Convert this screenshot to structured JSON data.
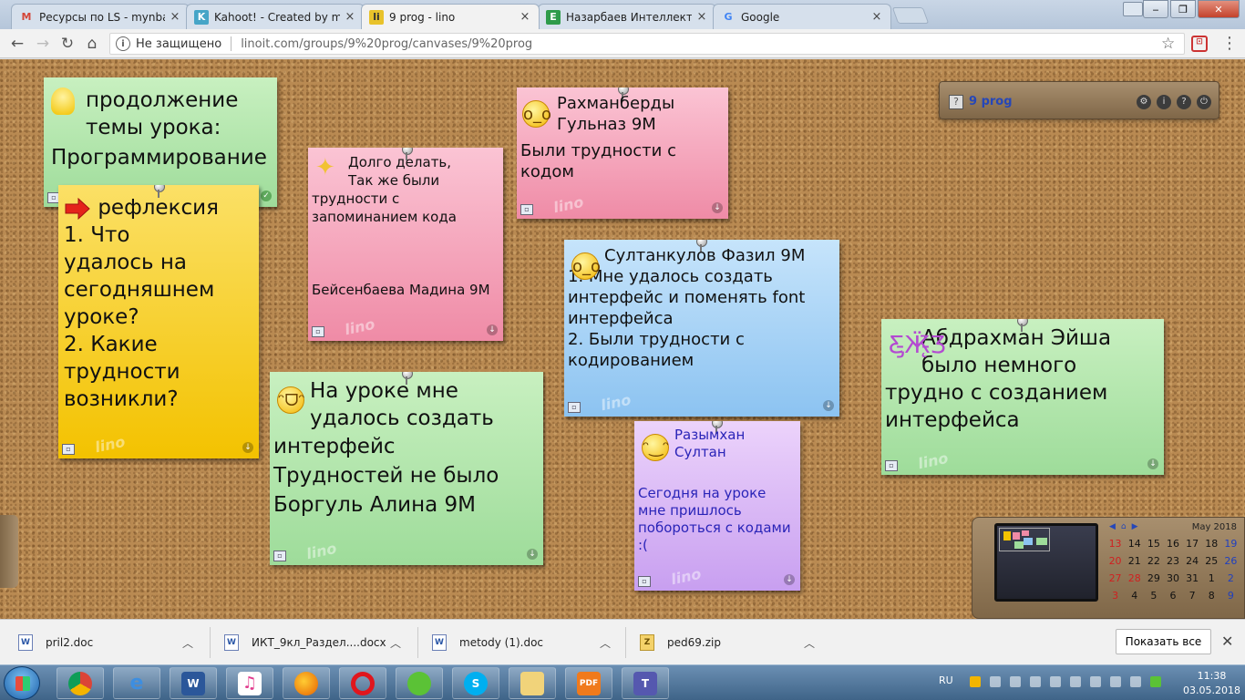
{
  "browser": {
    "tabs": [
      {
        "title": "Ресурсы по LS - mynbae",
        "favicon": "gmail-icon",
        "color": "#d44638",
        "glyph": "M"
      },
      {
        "title": "Kahoot! - Created by me",
        "favicon": "kahoot-icon",
        "color": "#46a5c7",
        "glyph": "K!"
      },
      {
        "title": "9 prog - lino",
        "favicon": "lino-icon",
        "color": "#e8c22a",
        "glyph": "li"
      },
      {
        "title": "Назарбаев Интеллектуа",
        "favicon": "sheet-icon",
        "color": "#2e9b4a",
        "glyph": "E"
      },
      {
        "title": "Google",
        "favicon": "google-icon",
        "color": "#4285f4",
        "glyph": "G"
      }
    ],
    "security_label": "Не защищено",
    "url": "linoit.com/groups/9%20prog/canvases/9%20prog"
  },
  "board": {
    "group_name": "9 prog",
    "group_panel_icons": [
      "settings-icon",
      "info-icon",
      "help-icon",
      "power-icon"
    ],
    "notes": [
      {
        "id": "n1",
        "emoji": "lightbulb-icon",
        "title": "продолжение\nтемы урока:",
        "body": "Программирование"
      },
      {
        "id": "n2",
        "emoji": "red-arrow-icon",
        "title": "рефлексия",
        "body": "     1. Что\nудалось на\nсегодняшнем\nуроке?\n2. Какие\nтрудности\nвозникли?"
      },
      {
        "id": "n3",
        "emoji": "sparkles-icon",
        "title": "Долго делать,\nТак же были",
        "body": "трудности с\nзапоминанием кода\n\n\n\nБейсенбаева Мадина 9М"
      },
      {
        "id": "n4",
        "emoji": "surprised-face-icon",
        "title": "Рахманберды\nГульназ 9М",
        "body": "Были трудности с\nкодом"
      },
      {
        "id": "n5",
        "emoji": "surprised-face-icon",
        "title": "Султанкулов Фазил 9М",
        "body": "     1. Мне удалось создать\nинтерфейс и поменять font\nинтерфейса\n2. Были трудности с\nкодированием"
      },
      {
        "id": "n6",
        "emoji": "grinning-face-icon",
        "title": "На уроке мне\nудалось создать",
        "body": "интерфейс\nТрудностей не было\nБоргуль Алина 9М"
      },
      {
        "id": "n7",
        "emoji": "smiling-face-icon",
        "title": "Разымхан\nСултан",
        "body": "Сегодня на уроке\nмне пришлось\nпобороться с кодами\n:("
      },
      {
        "id": "n8",
        "emoji": "butterfly-icon",
        "title": "Абдрахман Эйша\nбыло немного",
        "body": "трудно с созданием\nинтерфейса"
      }
    ],
    "watermark": "lino"
  },
  "calendar": {
    "month": "May 2018",
    "rows": [
      [
        "13",
        "14",
        "15",
        "16",
        "17",
        "18",
        "19"
      ],
      [
        "20",
        "21",
        "22",
        "23",
        "24",
        "25",
        "26"
      ],
      [
        "27",
        "28",
        "29",
        "30",
        "31",
        "1",
        "2"
      ],
      [
        "3",
        "4",
        "5",
        "6",
        "7",
        "8",
        "9"
      ]
    ]
  },
  "downloads": {
    "items": [
      "pril2.doc",
      "ИКТ_9кл_Раздел....docx",
      "metody (1).doc",
      "ped69.zip"
    ],
    "show_all": "Показать все"
  },
  "taskbar": {
    "apps": [
      "chrome-icon",
      "ie-icon",
      "word-icon",
      "itunes-icon",
      "firefox-icon",
      "opera-icon",
      "icq-icon",
      "skype-icon",
      "explorer-icon",
      "pdf-icon",
      "teams-icon"
    ],
    "language": "RU",
    "time": "11:38",
    "date": "03.05.2018"
  }
}
